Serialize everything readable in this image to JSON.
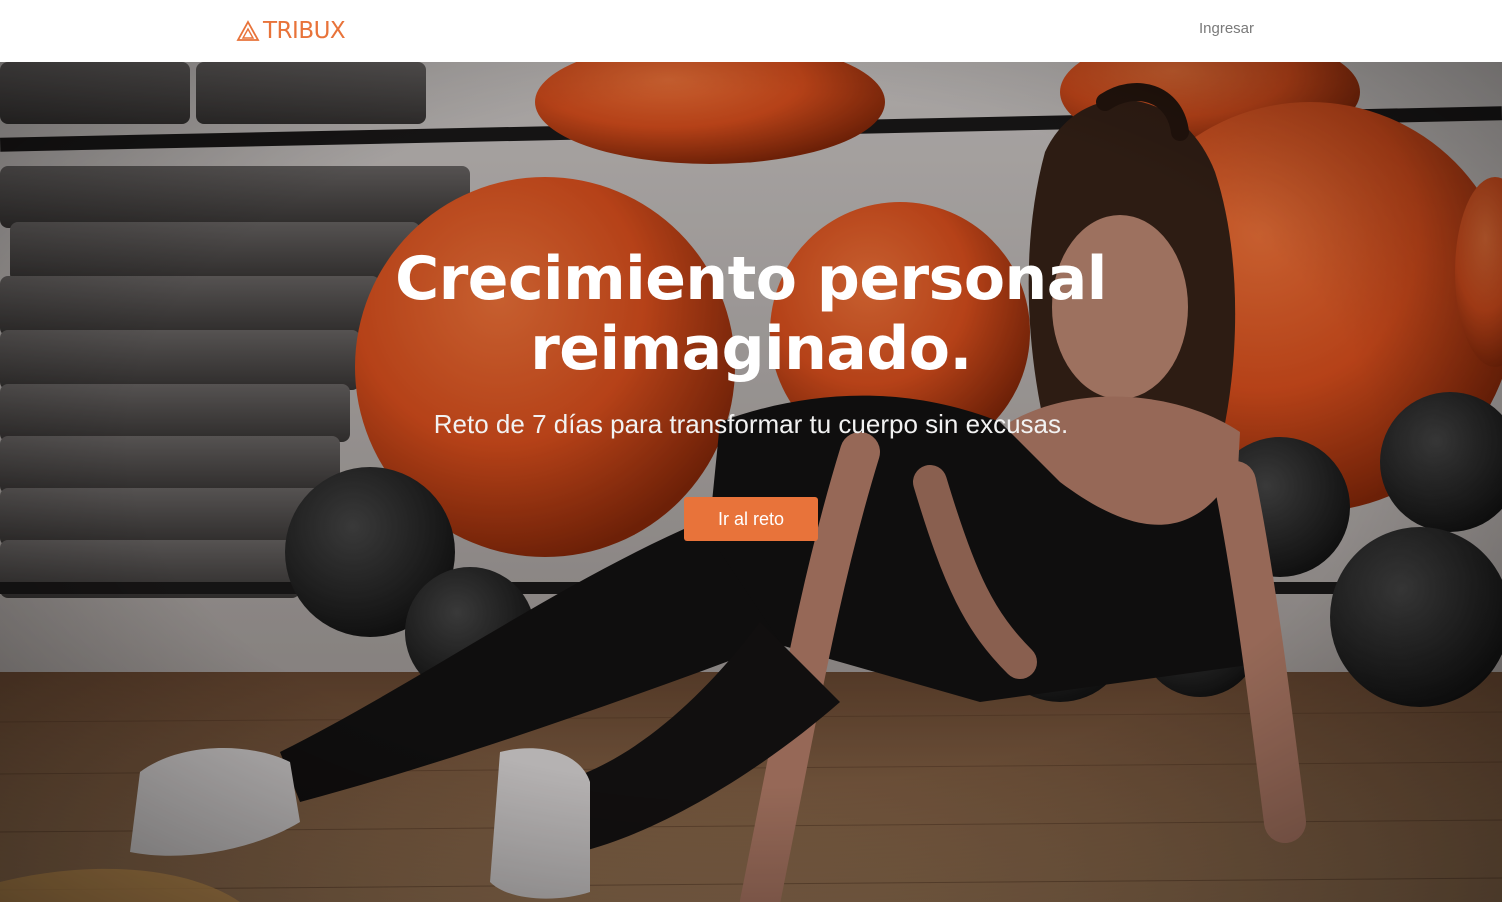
{
  "navbar": {
    "brand_name": "TRIBUX",
    "logo_icon": "triangle-logo-icon",
    "login_label": "Ingresar"
  },
  "hero": {
    "title": "Crecimiento personal reimaginado.",
    "subtitle": "Reto de 7 días para transformar tu cuerpo sin excusas.",
    "cta_label": "Ir al reto"
  },
  "colors": {
    "accent": "#e8733a",
    "nav_background": "#ffffff",
    "login_text": "#7a7a7a"
  }
}
